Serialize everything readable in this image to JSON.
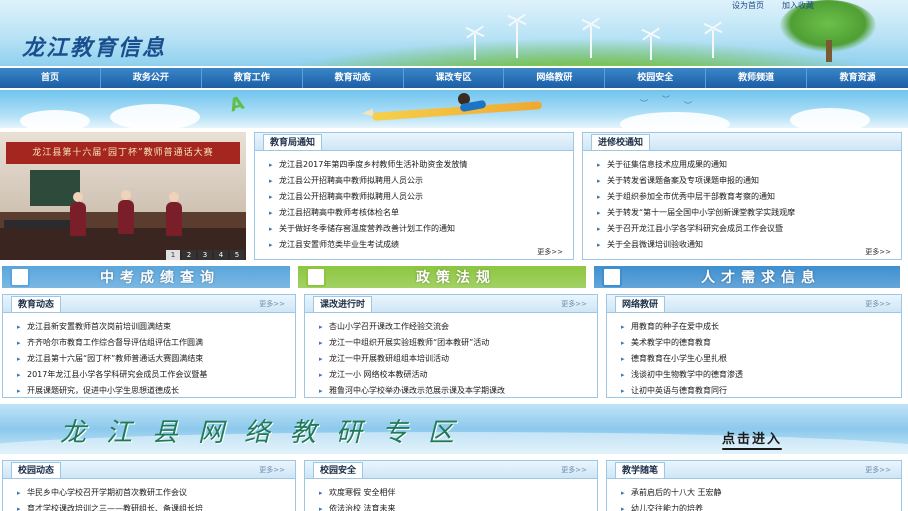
{
  "header": {
    "site_title": "龙江教育信息",
    "top_links": [
      "设为首页",
      "加入收藏"
    ]
  },
  "nav": [
    "首页",
    "政务公开",
    "教育工作",
    "教育动态",
    "课改专区",
    "网络教研",
    "校园安全",
    "教师频道",
    "教育资源"
  ],
  "slideshow": {
    "caption": "龙江县第十六届“园丁杯”教师普通话大赛",
    "pages": [
      "1",
      "2",
      "3",
      "4",
      "5"
    ]
  },
  "notice": {
    "title": "教育局通知",
    "items": [
      "龙江县2017年第四季度乡村教师生活补助资金发放情",
      "龙江县公开招聘高中教师拟聘用人员公示",
      "龙江县公开招聘高中教师拟聘用人员公示",
      "龙江县招聘高中教师考核体检名单",
      "关于做好冬季储存窖温度营养改善计划工作的通知",
      "龙江县安置师范类毕业生考试成绩"
    ],
    "more": "更多>>"
  },
  "training": {
    "title": "进修校通知",
    "items": [
      "关于征集信息技术应用成果的通知",
      "关于转发省课题备案及专项课题申报的通知",
      "关于组织参加全市优秀中层干部教育考察的通知",
      "关于转发“第十一届全国中小学创新课堂教学实践观摩",
      "关于召开龙江县小学各学科研究会成员工作会议暨",
      "关于全县微课培训验收通知"
    ],
    "more": "更多>>"
  },
  "quick_links": [
    {
      "label": "中考成绩查询",
      "color": "#5aa6dc",
      "icon": "magnifier-icon"
    },
    {
      "label": "政策法规",
      "color": "#8cc63f",
      "icon": "book-icon"
    },
    {
      "label": "人才需求信息",
      "color": "#3e8fd0",
      "icon": "phone-icon"
    }
  ],
  "sections_row1": [
    {
      "title": "教育动态",
      "more": "更多>>",
      "items": [
        "龙江县新安置教师首次岗前培训圆满结束",
        "齐齐哈尔市教育工作综合督导评估组评估工作圆满",
        "龙江县第十六届“园丁杯”教师普通话大赛圆满结束",
        "2017年龙江县小学各学科研究会成员工作会议暨基",
        "开展课题研究，促进中小学生思想道德成长"
      ]
    },
    {
      "title": "课改进行时",
      "more": "更多>>",
      "items": [
        "杏山小学召开课改工作经验交流会",
        "龙江一中组织开展实验班教师“团本教研”活动",
        "龙江一中开展教研组组本培训活动",
        "龙江一小 网络校本教研活动",
        "雅鲁河中心学校举办课改示范展示课及本学期课改"
      ]
    },
    {
      "title": "网络教研",
      "more": "更多>>",
      "items": [
        "用教育的种子在爱中成长",
        "美术教学中的德育教育",
        "德育教育在小学生心里扎根",
        "浅谈初中生物教学中的德育渗透",
        "让初中英语与德育教育同行"
      ]
    }
  ],
  "research_banner": {
    "title": "龙江县网络教研专区",
    "enter": "点击进入"
  },
  "sections_row2": [
    {
      "title": "校园动态",
      "more": "更多>>",
      "items": [
        "华民乡中心学校召开学期初首次教研工作会议",
        "育才学校课改培训之三——教研组长、备课组长培"
      ]
    },
    {
      "title": "校园安全",
      "more": "更多>>",
      "items": [
        "欢度寒假 安全相伴",
        "依法治校 法育未来"
      ]
    },
    {
      "title": "教学随笔",
      "more": "更多>>",
      "items": [
        "承前启后的十八大 王宏静",
        "幼儿交往能力的培养"
      ]
    }
  ]
}
